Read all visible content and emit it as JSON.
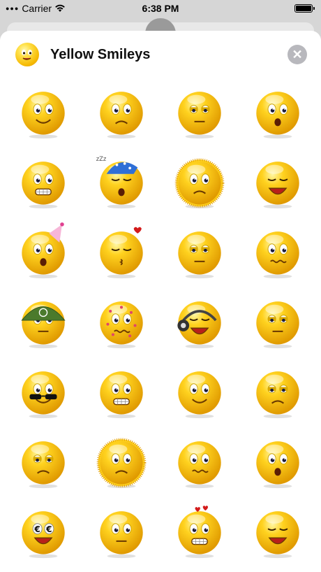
{
  "status": {
    "carrier": "Carrier",
    "time": "6:38 PM",
    "battery_level": 1.0
  },
  "header": {
    "title": "Yellow Smileys"
  },
  "colors": {
    "face_light": "#fff7a6",
    "face_mid": "#ffd21f",
    "face_dark": "#e09a00",
    "close_bg": "#b8b8bd"
  },
  "stickers": [
    {
      "name": "in-love-smiley",
      "mood": "love"
    },
    {
      "name": "sad-smiley",
      "mood": "sad"
    },
    {
      "name": "annoyed-smiley",
      "mood": "annoyed"
    },
    {
      "name": "worried-smiley",
      "mood": "worried"
    },
    {
      "name": "angry-teeth-smiley",
      "mood": "grit"
    },
    {
      "name": "sleepy-nightcap-smiley",
      "mood": "sleep"
    },
    {
      "name": "shocked-fuzzy-smiley",
      "mood": "shock"
    },
    {
      "name": "laughing-smiley",
      "mood": "laugh"
    },
    {
      "name": "party-hat-smiley",
      "mood": "party"
    },
    {
      "name": "kiss-smiley",
      "mood": "kiss"
    },
    {
      "name": "bored-smiley",
      "mood": "bored"
    },
    {
      "name": "nervous-smiley",
      "mood": "nervous"
    },
    {
      "name": "soldier-helmet-smiley",
      "mood": "soldier"
    },
    {
      "name": "measles-smiley",
      "mood": "measles"
    },
    {
      "name": "music-headphones-smiley",
      "mood": "music"
    },
    {
      "name": "suspicious-smiley",
      "mood": "suspicious"
    },
    {
      "name": "cool-sunglasses-smiley",
      "mood": "cool"
    },
    {
      "name": "grimace-smiley",
      "mood": "grit"
    },
    {
      "name": "happy-smiley",
      "mood": "happy"
    },
    {
      "name": "bruised-smiley",
      "mood": "bruised"
    },
    {
      "name": "frowning-smiley",
      "mood": "frown"
    },
    {
      "name": "scared-fuzzy-smiley",
      "mood": "scared"
    },
    {
      "name": "winking-bandage-smiley",
      "mood": "wink"
    },
    {
      "name": "whistling-smiley",
      "mood": "whistle"
    },
    {
      "name": "money-eyes-smiley",
      "mood": "money"
    },
    {
      "name": "curious-smiley",
      "mood": "curious"
    },
    {
      "name": "hearts-smiley",
      "mood": "hearts"
    },
    {
      "name": "relieved-smiley",
      "mood": "relieved"
    }
  ]
}
